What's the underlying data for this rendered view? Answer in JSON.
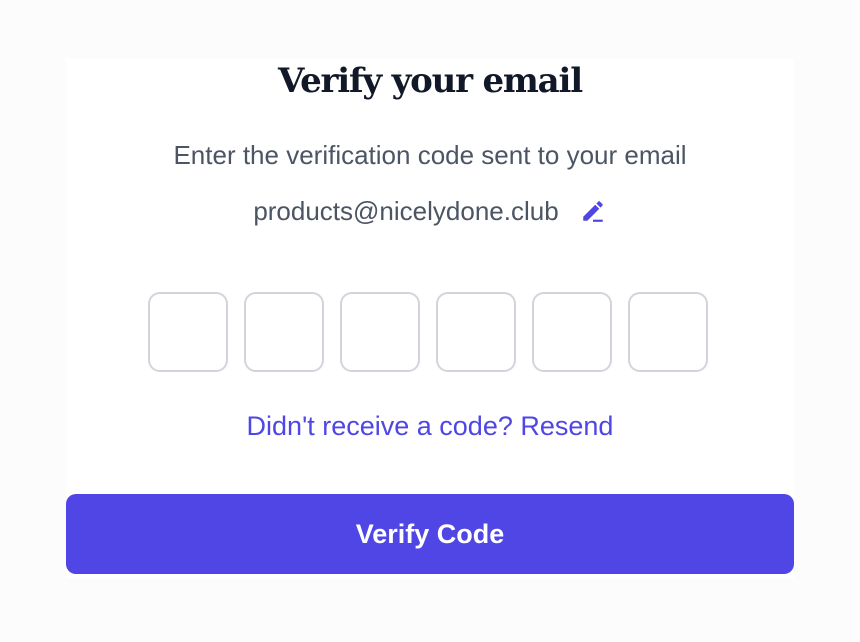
{
  "header": {
    "title": "Verify your email",
    "subtitle": "Enter the verification code sent to your email"
  },
  "email": {
    "address": "products@nicelydone.club",
    "edit_icon": "pencil-icon"
  },
  "otp": {
    "length": 6,
    "values": [
      "",
      "",
      "",
      "",
      "",
      ""
    ]
  },
  "resend": {
    "prompt": "Didn't receive a code? ",
    "link_label": "Resend"
  },
  "actions": {
    "verify_label": "Verify Code"
  },
  "colors": {
    "accent": "#4f46e5",
    "title": "#111827",
    "body_text": "#4b5563",
    "input_border": "#d1d5db"
  }
}
